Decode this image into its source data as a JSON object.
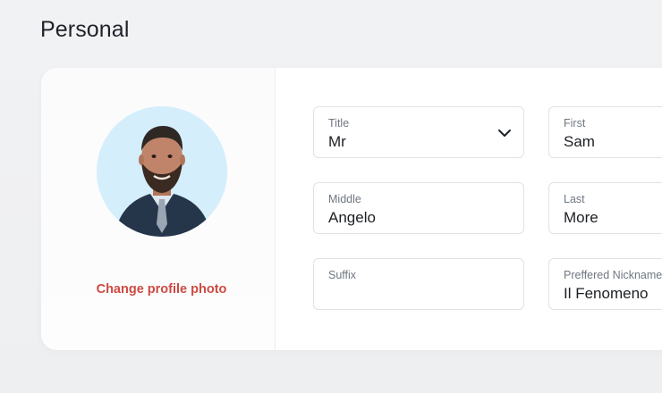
{
  "page": {
    "title": "Personal"
  },
  "profile": {
    "change_photo_label": "Change profile photo",
    "avatar_bg": "#d5eefc"
  },
  "form": {
    "title": {
      "label": "Title",
      "value": "Mr"
    },
    "first": {
      "label": "First",
      "value": "Sam"
    },
    "middle": {
      "label": "Middle",
      "value": "Angelo"
    },
    "last": {
      "label": "Last",
      "value": "More"
    },
    "suffix": {
      "label": "Suffix",
      "value": ""
    },
    "nickname": {
      "label": "Preffered Nickname",
      "value": "Il Fenomeno"
    }
  },
  "colors": {
    "accent": "#cc4a43",
    "field_border": "#dfe2e6"
  }
}
